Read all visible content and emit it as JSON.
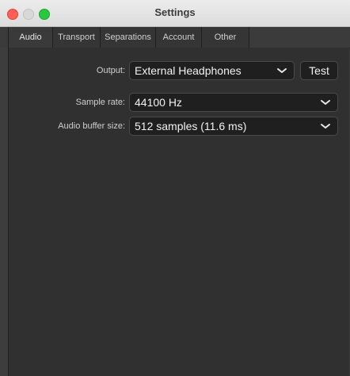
{
  "window": {
    "title": "Settings"
  },
  "tabs": [
    "Audio",
    "Transport",
    "Separations",
    "Account",
    "Other"
  ],
  "active_tab": "Audio",
  "audio": {
    "output": {
      "label": "Output:",
      "value": "External Headphones"
    },
    "test_button": "Test",
    "sample_rate": {
      "label": "Sample rate:",
      "value": "44100 Hz"
    },
    "buffer_size": {
      "label": "Audio buffer size:",
      "value": "512 samples (11.6 ms)"
    }
  },
  "colors": {
    "close": "#ff5f57",
    "minimize": "#d8d8d8",
    "maximize": "#2ac840",
    "panel": "#303030",
    "field": "#1f1f1f"
  }
}
